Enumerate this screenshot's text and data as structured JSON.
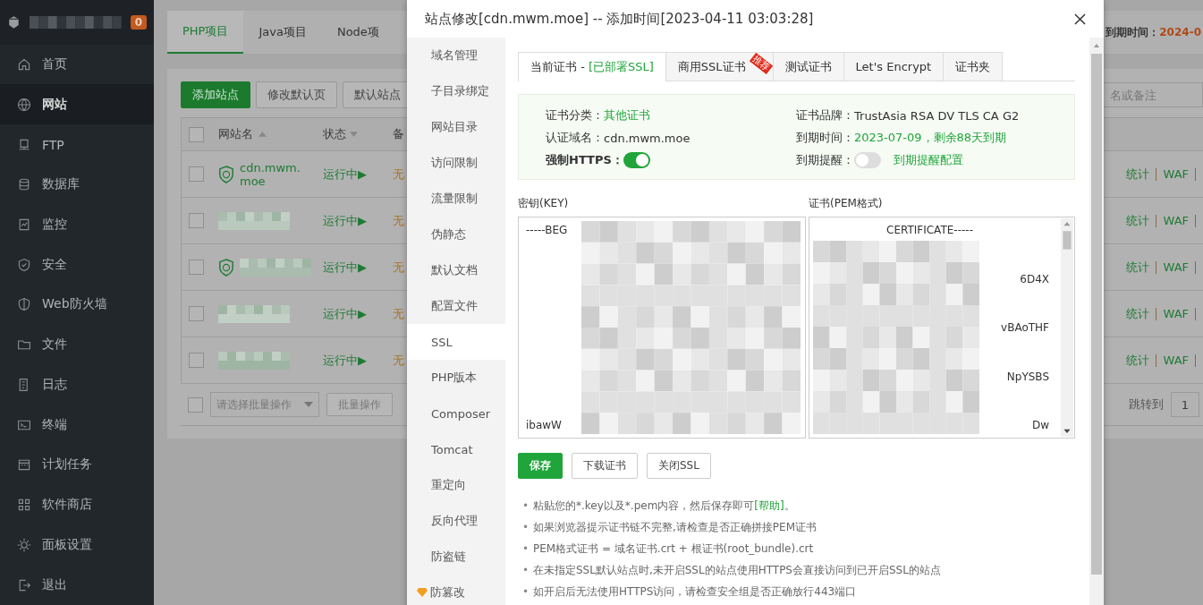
{
  "sidebar": {
    "badge": "0",
    "items": [
      {
        "label": "首页",
        "selected": false
      },
      {
        "label": "网站",
        "selected": true
      },
      {
        "label": "FTP",
        "selected": false
      },
      {
        "label": "数据库",
        "selected": false
      },
      {
        "label": "监控",
        "selected": false
      },
      {
        "label": "安全",
        "selected": false
      },
      {
        "label": "Web防火墙",
        "selected": false
      },
      {
        "label": "文件",
        "selected": false
      },
      {
        "label": "日志",
        "selected": false
      },
      {
        "label": "终端",
        "selected": false
      },
      {
        "label": "计划任务",
        "selected": false
      },
      {
        "label": "软件商店",
        "selected": false
      },
      {
        "label": "面板设置",
        "selected": false
      },
      {
        "label": "退出",
        "selected": false
      }
    ]
  },
  "project_tabs": [
    {
      "label": "PHP项目",
      "selected": true
    },
    {
      "label": "Java项目",
      "selected": false
    },
    {
      "label": "Node项",
      "selected": false
    }
  ],
  "expiry": {
    "label": "到期时间：",
    "value": "2024-0"
  },
  "toolbar_buttons": [
    {
      "label": "添加站点",
      "kind": "primary"
    },
    {
      "label": "修改默认页",
      "kind": "default"
    },
    {
      "label": "默认站点",
      "kind": "default"
    }
  ],
  "search": {
    "placeholder": "名或备注"
  },
  "table": {
    "columns": [
      "网站名",
      "状态",
      "备"
    ],
    "all_checked": false,
    "rows": [
      {
        "name": "cdn.mwm.moe",
        "checked": false,
        "redacted": false,
        "waf": true,
        "status": "运行中▶",
        "backup": "无",
        "actions": [
          "统计",
          "WAF"
        ]
      },
      {
        "checked": false,
        "redacted": true,
        "waf": false,
        "status": "运行中▶",
        "backup": "无",
        "actions": [
          "统计",
          "WAF"
        ]
      },
      {
        "checked": false,
        "redacted": true,
        "waf": true,
        "status": "运行中▶",
        "backup": "无",
        "actions": [
          "统计",
          "WAF"
        ]
      },
      {
        "checked": false,
        "redacted": true,
        "waf": false,
        "status": "运行中▶",
        "backup": "无",
        "actions": [
          "统计",
          "WAF"
        ]
      },
      {
        "checked": false,
        "redacted": true,
        "waf": false,
        "status": "运行中▶",
        "backup": "无",
        "actions": [
          "统计",
          "WAF"
        ]
      }
    ]
  },
  "batch": {
    "checked": false,
    "placeholder": "请选择批量操作",
    "button": "批量操作"
  },
  "pager": {
    "label": "跳转到",
    "page": "1"
  },
  "dialog": {
    "title": "站点修改[cdn.mwm.moe] -- 添加时间[2023-04-11 03:03:28]",
    "menu": [
      {
        "label": "域名管理",
        "selected": false
      },
      {
        "label": "子目录绑定",
        "selected": false
      },
      {
        "label": "网站目录",
        "selected": false
      },
      {
        "label": "访问限制",
        "selected": false
      },
      {
        "label": "流量限制",
        "selected": false
      },
      {
        "label": "伪静态",
        "selected": false
      },
      {
        "label": "默认文档",
        "selected": false
      },
      {
        "label": "配置文件",
        "selected": false
      },
      {
        "label": "SSL",
        "selected": true
      },
      {
        "label": "PHP版本",
        "selected": false
      },
      {
        "label": "Composer",
        "selected": false
      },
      {
        "label": "Tomcat",
        "selected": false
      },
      {
        "label": "重定向",
        "selected": false
      },
      {
        "label": "反向代理",
        "selected": false
      },
      {
        "label": "防盗链",
        "selected": false
      },
      {
        "label": "防篡改",
        "selected": false,
        "kind": "pro"
      }
    ],
    "tabs": [
      {
        "label": "当前证书 - ",
        "status": "[已部署SSL]",
        "selected": true
      },
      {
        "label": "商用SSL证书",
        "badge": "推荐",
        "selected": false
      },
      {
        "label": "测试证书",
        "selected": false
      },
      {
        "label": "Let's Encrypt",
        "selected": false
      },
      {
        "label": "证书夹",
        "selected": false
      }
    ],
    "info": [
      {
        "label": "证书分类：",
        "kind": "text",
        "value": "其他证书",
        "highlighted": true
      },
      {
        "label": "证书品牌：",
        "kind": "text",
        "value": "TrustAsia RSA DV TLS CA G2",
        "highlighted": false
      },
      {
        "label": "认证域名：",
        "kind": "text",
        "value": "cdn.mwm.moe",
        "highlighted": false
      },
      {
        "label": "到期时间：",
        "kind": "text",
        "value": "2023-07-09，剩余88天到期",
        "highlighted": true
      },
      {
        "label": "强制HTTPS：",
        "kind": "switch",
        "on": true
      },
      {
        "label": "到期提醒：",
        "kind": "switch",
        "on": false,
        "link": "到期提醒配置"
      }
    ],
    "key": {
      "label": "密钥(KEY)",
      "lines": [
        "-----BEG",
        "ibawW"
      ]
    },
    "cert": {
      "label": "证书(PEM格式)",
      "lines": [
        "CERTIFICATE-----",
        "6D4X",
        "vBAoTHF",
        "NpYSBS",
        "Dw"
      ]
    },
    "buttons": [
      {
        "label": "保存",
        "kind": "primary"
      },
      {
        "label": "下载证书",
        "kind": "default"
      },
      {
        "label": "关闭SSL",
        "kind": "default"
      }
    ],
    "notes": [
      {
        "marker": "•",
        "text": "粘贴您的*.key以及*.pem内容，然后保存即可",
        "link": "[帮助]",
        "tail": "。"
      },
      {
        "marker": "•",
        "text": "如果浏览器提示证书链不完整,请检查是否正确拼接PEM证书"
      },
      {
        "marker": "•",
        "text": "PEM格式证书 = 域名证书.crt + 根证书(root_bundle).crt"
      },
      {
        "marker": "•",
        "text": "在未指定SSL默认站点时,未开启SSL的站点使用HTTPS会直接访问到已开启SSL的站点"
      },
      {
        "marker": "•",
        "text": "如开启后无法使用HTTPS访问，请检查安全组是否正确放行443端口"
      }
    ]
  }
}
